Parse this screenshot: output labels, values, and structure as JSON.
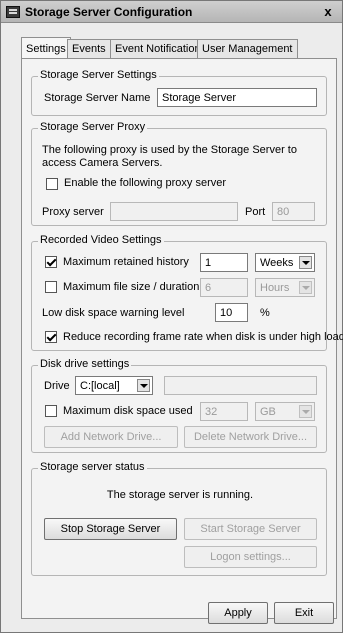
{
  "window": {
    "title": "Storage Server Configuration",
    "close_glyph": "x",
    "icon": "app-window-icon"
  },
  "tabs": [
    {
      "label": "Settings",
      "active": true
    },
    {
      "label": "Events",
      "active": false
    },
    {
      "label": "Event Notification",
      "active": false
    },
    {
      "label": "User Management",
      "active": false
    }
  ],
  "storage_settings": {
    "legend": "Storage Server Settings",
    "name_label": "Storage Server Name",
    "name_value": "Storage Server"
  },
  "proxy": {
    "legend": "Storage Server Proxy",
    "description": "The following proxy is used by the Storage Server to access Camera Servers.",
    "enable_label": "Enable the following proxy server",
    "enable_checked": false,
    "server_label": "Proxy server",
    "server_value": "",
    "port_label": "Port",
    "port_value": "80"
  },
  "video": {
    "legend": "Recorded Video Settings",
    "history_label": "Maximum retained history",
    "history_checked": true,
    "history_value": "1",
    "history_unit": "Weeks",
    "filesize_label": "Maximum file size / duration",
    "filesize_checked": false,
    "filesize_value": "6",
    "filesize_unit": "Hours",
    "lowdisk_label": "Low disk space warning level",
    "lowdisk_value": "10",
    "lowdisk_unit": "%",
    "reduce_label": "Reduce recording frame rate when disk is under high load",
    "reduce_checked": true
  },
  "disk": {
    "legend": "Disk drive settings",
    "drive_label": "Drive",
    "drive_value": "C:[local]",
    "drive_path": "",
    "maxspace_label": "Maximum disk space used",
    "maxspace_checked": false,
    "maxspace_value": "32",
    "maxspace_unit": "GB",
    "add_label": "Add Network Drive...",
    "delete_label": "Delete Network Drive..."
  },
  "status": {
    "legend": "Storage server status",
    "message": "The storage server is running.",
    "stop_label": "Stop Storage Server",
    "start_label": "Start Storage Server",
    "logon_label": "Logon settings..."
  },
  "footer": {
    "apply_label": "Apply",
    "exit_label": "Exit"
  }
}
